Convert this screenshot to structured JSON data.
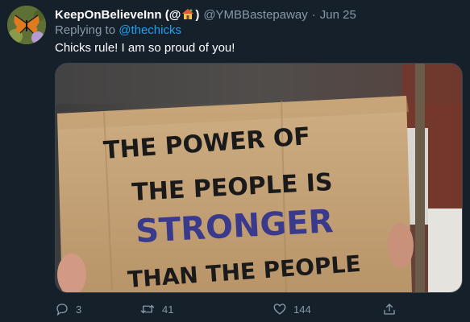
{
  "tweet": {
    "display_name": "KeepOnBelieveInn (@",
    "display_name_close": ")",
    "handle": "@YMBBastepaway",
    "separator": "·",
    "date": "Jun 25",
    "replying_to_prefix": "Replying to",
    "replying_to_mention": "@thechicks",
    "text": "Chicks rule! I am so proud of you!",
    "image": {
      "sign_lines": [
        "THE POWER OF",
        "THE PEOPLE IS",
        "STRONGER",
        "THAN THE PEOPLE"
      ],
      "accent_word_color": "#3a3a8c",
      "ink_color": "#1a1a1a",
      "cardboard_color": "#c9a77c"
    }
  },
  "actions": {
    "reply_count": "3",
    "retweet_count": "41",
    "like_count": "144",
    "reply_icon": "speech-bubble-icon",
    "retweet_icon": "retweet-arrows-icon",
    "like_icon": "heart-outline-icon",
    "share_icon": "share-upload-icon"
  },
  "colors": {
    "background": "#15202b",
    "secondary_text": "#8899a6",
    "link": "#1da1f2"
  }
}
